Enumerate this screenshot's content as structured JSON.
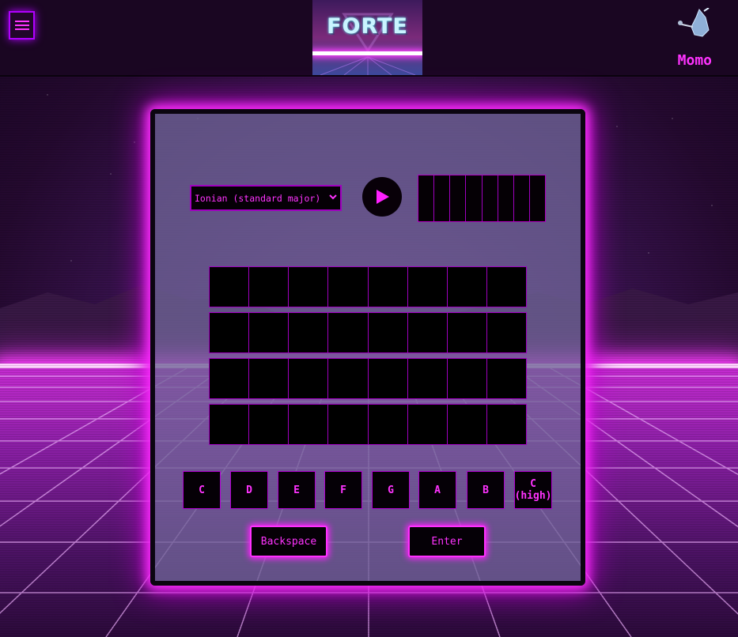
{
  "header": {
    "logo_text": "FORTE",
    "username": "Momo"
  },
  "game": {
    "mode_select": {
      "selected": "Ionian (standard major)"
    },
    "sequence_slots": 8,
    "grid": {
      "rows": 4,
      "cols": 8
    },
    "keys": [
      {
        "label": "C"
      },
      {
        "label": "D"
      },
      {
        "label": "E"
      },
      {
        "label": "F"
      },
      {
        "label": "G"
      },
      {
        "label": "A"
      },
      {
        "label": "B"
      },
      {
        "label": "C",
        "sublabel": "(high)"
      }
    ],
    "backspace_label": "Backspace",
    "enter_label": "Enter"
  },
  "colors": {
    "accent": "#ff33ff",
    "border": "#a000c0",
    "cell": "#000000"
  },
  "icons": {
    "menu": "hamburger-icon",
    "play": "play-icon",
    "select": "chevron-down-icon"
  }
}
